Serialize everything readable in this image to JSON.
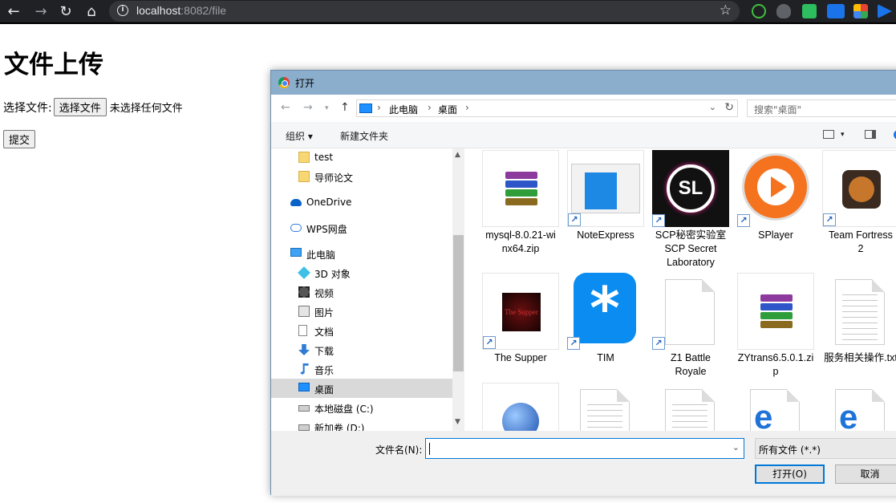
{
  "browser": {
    "url_host": "localhost",
    "url_rest": ":8082/file"
  },
  "page": {
    "title": "文件上传",
    "file_label": "选择文件:",
    "choose_button": "选择文件",
    "no_file_text": "未选择任何文件",
    "submit_button": "提交"
  },
  "dialog": {
    "title": "打开",
    "breadcrumb": [
      "此电脑",
      "桌面"
    ],
    "search_placeholder": "搜索\"桌面\"",
    "toolbar": {
      "organize": "组织 ▾",
      "new_folder": "新建文件夹"
    },
    "nav_items": [
      {
        "label": "test",
        "icon": "folder-icon"
      },
      {
        "label": "导师论文",
        "icon": "folder-icon"
      },
      {
        "label": "OneDrive",
        "icon": "onedrive-icon"
      },
      {
        "label": "WPS网盘",
        "icon": "cloud-icon"
      },
      {
        "label": "此电脑",
        "icon": "computer-icon"
      },
      {
        "label": "3D 对象",
        "icon": "3d-objects-icon"
      },
      {
        "label": "视频",
        "icon": "video-icon"
      },
      {
        "label": "图片",
        "icon": "pictures-icon"
      },
      {
        "label": "文档",
        "icon": "documents-icon"
      },
      {
        "label": "下载",
        "icon": "download-icon"
      },
      {
        "label": "音乐",
        "icon": "music-icon"
      },
      {
        "label": "桌面",
        "icon": "desktop-icon",
        "selected": true
      },
      {
        "label": "本地磁盘 (C:)",
        "icon": "disk-icon"
      },
      {
        "label": "新加卷 (D:)",
        "icon": "disk-icon"
      }
    ],
    "files": [
      {
        "label": "mysql-8.0.21-winx64.zip",
        "label_lines": [
          "mysql-8.0.21-wi",
          "nx64.zip"
        ],
        "icon": "winrar-icon",
        "shortcut": false
      },
      {
        "label": "NoteExpress",
        "label_lines": [
          "NoteExpress"
        ],
        "icon": "noteexpress-icon",
        "shortcut": true
      },
      {
        "label": "SCP秘密实验室 SCP Secret Laboratory",
        "label_lines": [
          "SCP秘密实验室",
          "SCP Secret",
          "Laboratory"
        ],
        "icon": "scp-sl-icon",
        "shortcut": true
      },
      {
        "label": "SPlayer",
        "label_lines": [
          "SPlayer"
        ],
        "icon": "splayer-icon",
        "shortcut": true
      },
      {
        "label": "Team Fortress 2",
        "label_lines": [
          "Team Fortress",
          "2"
        ],
        "icon": "tf2-icon",
        "shortcut": true
      },
      {
        "label": "The Supper",
        "label_lines": [
          "The Supper"
        ],
        "icon": "the-supper-icon",
        "shortcut": true
      },
      {
        "label": "TIM",
        "label_lines": [
          "TIM"
        ],
        "icon": "tim-icon",
        "shortcut": true
      },
      {
        "label": "Z1 Battle Royale",
        "label_lines": [
          "Z1 Battle",
          "Royale"
        ],
        "icon": "blank-file-icon",
        "shortcut": true
      },
      {
        "label": "ZYtrans6.5.0.1.zip",
        "label_lines": [
          "ZYtrans6.5.0.1.zi",
          "p"
        ],
        "icon": "winrar-icon",
        "shortcut": false
      },
      {
        "label": "服务相关操作.txt",
        "label_lines": [
          "服务相关操作.txt"
        ],
        "icon": "text-file-icon",
        "shortcut": false
      },
      {
        "label": "",
        "label_lines": [],
        "icon": "network-globe-icon",
        "shortcut": false
      },
      {
        "label": "",
        "label_lines": [],
        "icon": "text-file-icon",
        "shortcut": false
      },
      {
        "label": "",
        "label_lines": [],
        "icon": "text-file-icon",
        "shortcut": false
      },
      {
        "label": "",
        "label_lines": [],
        "icon": "edge-icon",
        "shortcut": false
      },
      {
        "label": "",
        "label_lines": [],
        "icon": "edge-icon",
        "shortcut": false
      }
    ],
    "filename_label": "文件名(N):",
    "filename_value": "",
    "filetype": "所有文件 (*.*)",
    "open_button": "打开(O)",
    "cancel_button": "取消"
  },
  "colors": {
    "dialog_title_bar": "#8caecd",
    "accent": "#0078d7",
    "browser_bar": "#202124"
  }
}
